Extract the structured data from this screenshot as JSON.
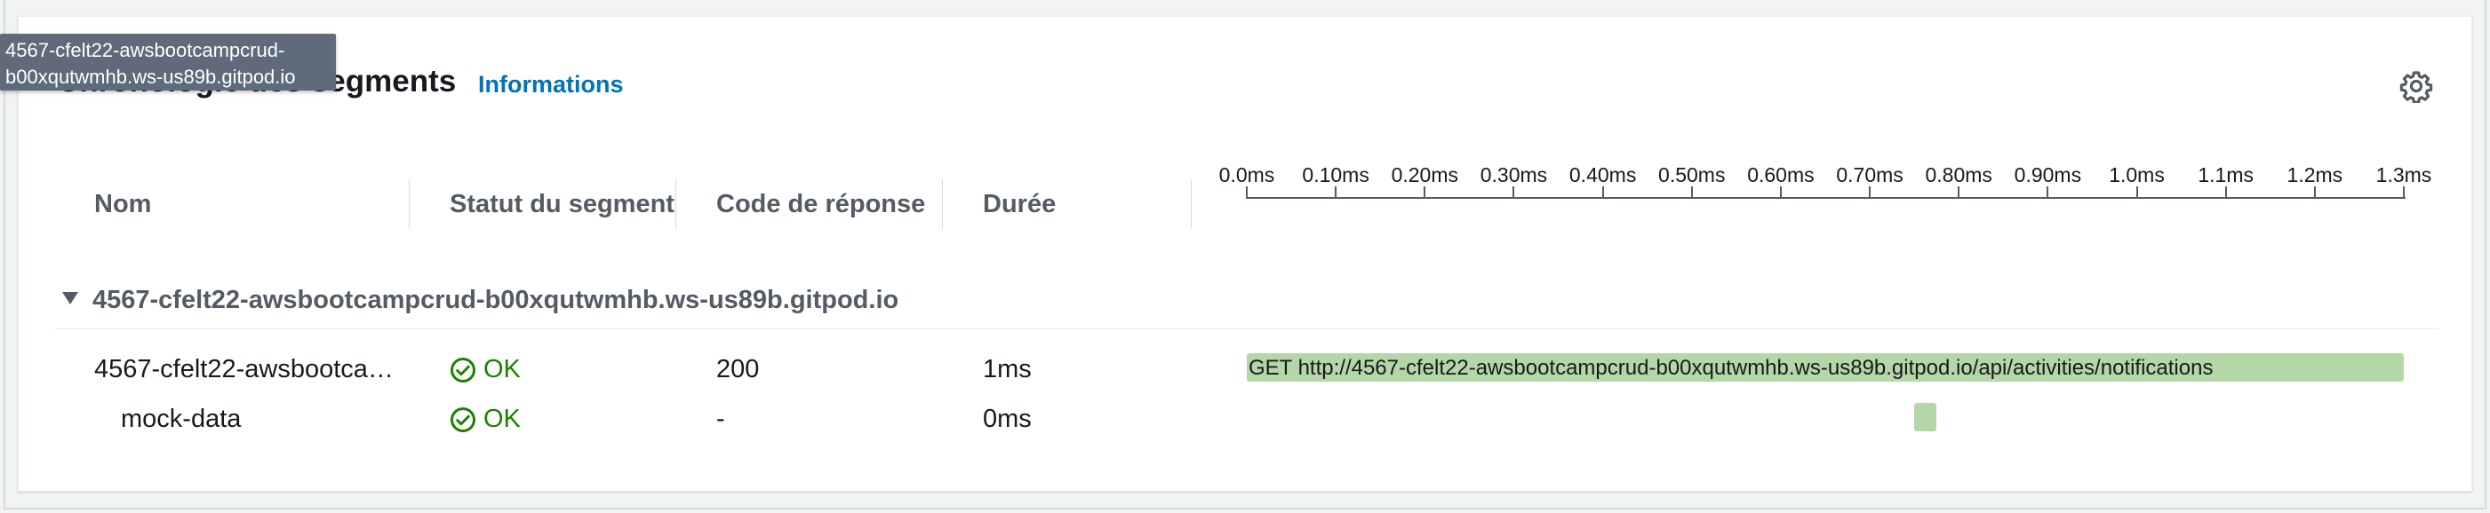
{
  "panel": {
    "title": "Chronologie des segments",
    "info_link": "Informations",
    "settings_icon": "gear-icon"
  },
  "tooltip": {
    "line1": "4567-cfelt22-awsbootcampcrud-",
    "line2": "b00xqutwmhb.ws-us89b.gitpod.io"
  },
  "columns": {
    "name": "Nom",
    "status": "Statut du segment",
    "response_code": "Code de réponse",
    "duration": "Durée"
  },
  "timeline_axis": {
    "unit": "ms",
    "ticks": [
      "0.0ms",
      "0.10ms",
      "0.20ms",
      "0.30ms",
      "0.40ms",
      "0.50ms",
      "0.60ms",
      "0.70ms",
      "0.80ms",
      "0.90ms",
      "1.0ms",
      "1.1ms",
      "1.2ms",
      "1.3ms"
    ],
    "max_ms": 1.3
  },
  "group": {
    "name": "4567-cfelt22-awsbootcampcrud-b00xqutwmhb.ws-us89b.gitpod.io",
    "expanded": true
  },
  "segments": [
    {
      "name": "4567-cfelt22-awsbootca…",
      "status": "OK",
      "response_code": "200",
      "duration": "1ms",
      "bar_label": "GET http://4567-cfelt22-awsbootcampcrud-b00xqutwmhb.ws-us89b.gitpod.io/api/activities/notifications",
      "start_ms": 0.0,
      "end_ms": 1.3
    },
    {
      "name": "mock-data",
      "status": "OK",
      "response_code": "-",
      "duration": "0ms",
      "bar_label": "",
      "start_ms": 0.75,
      "end_ms": 0.775
    }
  ],
  "colors": {
    "ok_green": "#1d8102",
    "bar_green": "#b5d6a7",
    "link_blue": "#0073bb",
    "tooltip_bg": "#5f6b7a"
  }
}
